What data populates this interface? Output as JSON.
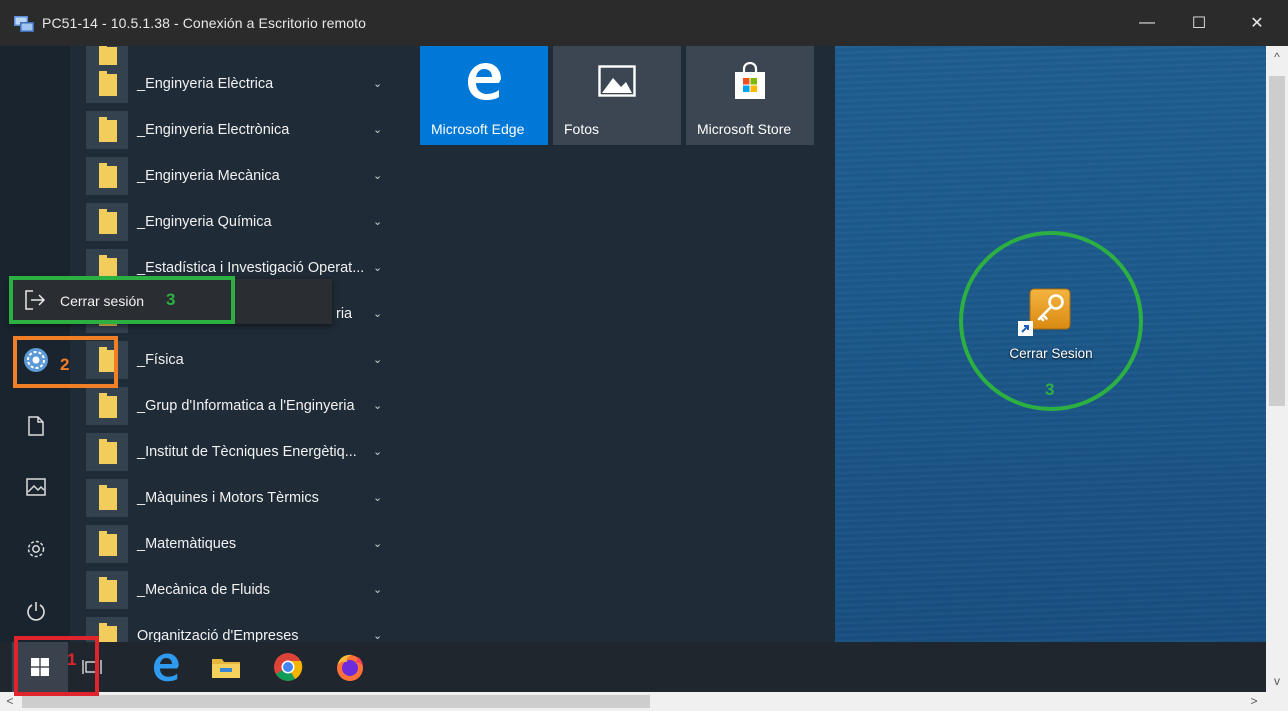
{
  "window": {
    "title": "PC51-14 - 10.5.1.38 - Conexión a Escritorio remoto",
    "minimize_icon": "—",
    "maximize_icon": "☐",
    "close_icon": "✕"
  },
  "start_menu": {
    "apps": [
      {
        "label": "_Enginyeria Elèctrica"
      },
      {
        "label": "_Enginyeria Electrònica"
      },
      {
        "label": "_Enginyeria Mecànica"
      },
      {
        "label": "_Enginyeria Química"
      },
      {
        "label": "_Estadística i Investigació Operat..."
      },
      {
        "label": "ria"
      },
      {
        "label": "_Física"
      },
      {
        "label": "_Grup d'Informatica a l'Enginyeria"
      },
      {
        "label": "_Institut de Tècniques Energètiq..."
      },
      {
        "label": "_Màquines i Motors Tèrmics"
      },
      {
        "label": "_Matemàtiques"
      },
      {
        "label": "_Mecànica de Fluids"
      },
      {
        "label": "Organització d'Empreses"
      }
    ],
    "tiles": [
      {
        "label": "Microsoft Edge",
        "color": "#0078d7"
      },
      {
        "label": "Fotos",
        "color": "#3b4652"
      },
      {
        "label": "Microsoft Store",
        "color": "#3b4652"
      }
    ],
    "popup": {
      "label": "Cerrar sesión"
    }
  },
  "desktop": {
    "icon_label": "Cerrar Sesion"
  },
  "annotations": {
    "num1": "1",
    "num2": "2",
    "num3_popup": "3",
    "num3_desktop": "3",
    "red": "#e0242d",
    "orange": "#f07f26",
    "green": "#2db042"
  },
  "scrollbar": {
    "up": "^",
    "down": "v",
    "left": "<",
    "right": ">"
  }
}
